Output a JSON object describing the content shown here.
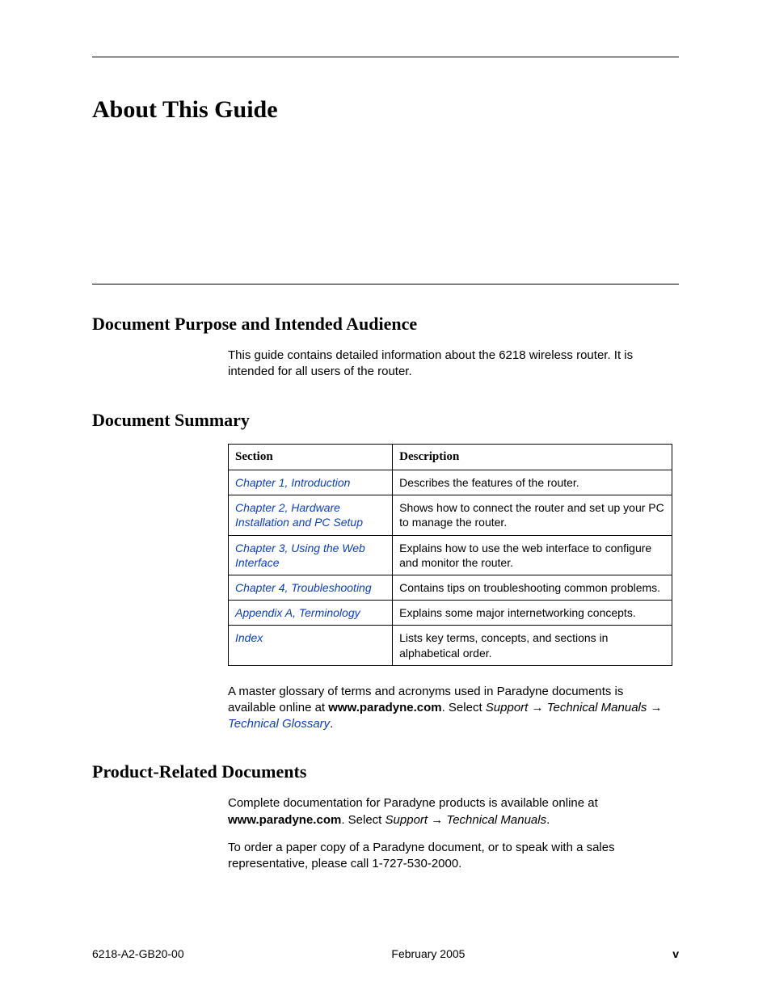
{
  "title": "About This Guide",
  "sections": {
    "purpose": {
      "heading": "Document Purpose and Intended Audience",
      "body": "This guide contains detailed information about the 6218 wireless router. It is intended for all users of the router."
    },
    "summary": {
      "heading": "Document Summary",
      "table": {
        "head": {
          "section": "Section",
          "description": "Description"
        },
        "rows": [
          {
            "section_prefix": "Chapter 1, ",
            "section_title": "Introduction",
            "description": "Describes the features of the router."
          },
          {
            "section_prefix": "Chapter 2, ",
            "section_title": "Hardware Installation and PC Setup",
            "description": "Shows how to connect the router and set up your PC to manage the router."
          },
          {
            "section_prefix": "Chapter 3, ",
            "section_title": "Using the Web Interface",
            "description": "Explains how to use the web interface to configure and monitor the router."
          },
          {
            "section_prefix": "Chapter 4, ",
            "section_title": "Troubleshooting",
            "description": "Contains tips on troubleshooting common problems."
          },
          {
            "section_prefix": "Appendix A, ",
            "section_title": "Terminology",
            "description": "Explains some major internetworking concepts."
          },
          {
            "section_prefix": "",
            "section_title": "Index",
            "description": "Lists key terms, concepts, and sections in alphabetical order."
          }
        ]
      },
      "glossary": {
        "pre": "A master glossary of terms and acronyms used in Paradyne documents is available online at ",
        "site": "www.paradyne.com",
        "mid": ". Select ",
        "nav1": "Support",
        "arrow": " → ",
        "nav2": "Technical Manuals",
        "arrow2": " → ",
        "link": "Technical Glossary",
        "post": "."
      }
    },
    "related": {
      "heading": "Product-Related Documents",
      "p1_pre": "Complete documentation for Paradyne products is available online at ",
      "p1_site": "www.paradyne.com",
      "p1_mid": ". Select ",
      "p1_nav1": "Support",
      "p1_arrow": " → ",
      "p1_nav2": "Technical Manuals",
      "p1_post": ".",
      "p2": "To order a paper copy of a Paradyne document, or to speak with a sales representative, please call 1-727-530-2000."
    }
  },
  "footer": {
    "left": "6218-A2-GB20-00",
    "center": "February 2005",
    "right": "v"
  }
}
